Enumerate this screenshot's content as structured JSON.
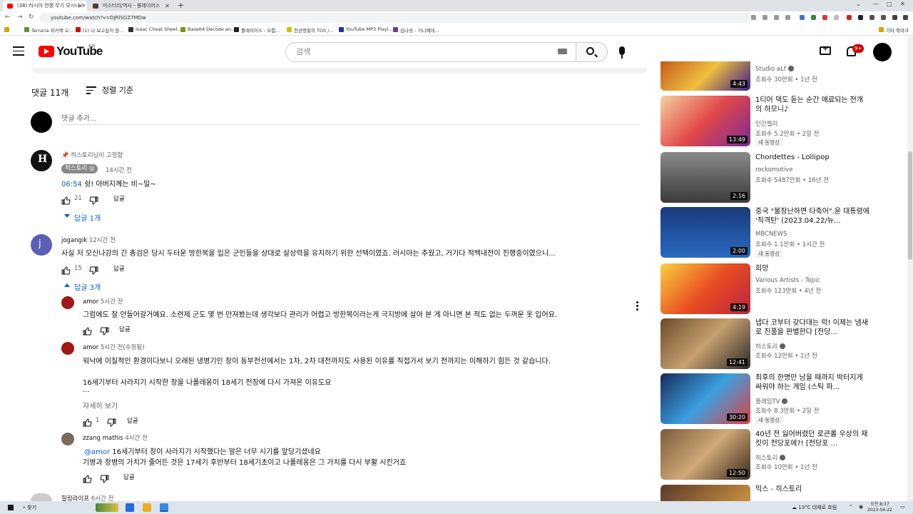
{
  "browser": {
    "tabs": [
      {
        "label": "(38) 러시아 전쟁 무기 모시나 ㅎ",
        "active": true
      },
      {
        "label": "미스터리/역사 - 롤레이어스",
        "active": false
      }
    ],
    "url": "youtube.com/watch?v=DJRlSGZ7MDw",
    "bookmarks": [
      "Terraria 위키백 오...",
      "(1) 나 보고싶지 않...",
      "Isaac Cheat Sheet...",
      "Base64 Decode an...",
      "롤레이어스 - 모험...",
      "천상병들의 TOS /...",
      "YouTube MP3 Playl...",
      "김나성 - 거니예데..."
    ],
    "other_bookmarks": "기타 북마크"
  },
  "header": {
    "logo_text": "YouTube",
    "region": "KR",
    "search_placeholder": "검색",
    "notif_count": "9+"
  },
  "comments_header": {
    "count": "댓글 11개",
    "sort_label": "정렬 기준",
    "add_placeholder": "댓글 추가..."
  },
  "comments": {
    "pinned": {
      "pinned_label": "히스토리님이 고정함",
      "author": "히스토리",
      "time": "14시간 전",
      "timestamp_link": "06:54",
      "text": " 쉿! 아버지께는 비~밀~",
      "likes": "21",
      "reply": "답글",
      "replies_toggle": "답글 1개"
    },
    "second": {
      "author": "jogangik",
      "time": "12시간 전",
      "text": "사실 저 모신나강의 긴 총검은 당시 두터운 방한복을 입은 군인들을 상대로 살상력을 유지하기 위한 선택이였죠. 러시아는 추웠고, 거기다 적백내전이 진행중이였으니...",
      "likes": "15",
      "reply": "답글",
      "replies_toggle": "답글 3개",
      "avatar_letter": "j"
    },
    "replies": [
      {
        "author": "amor",
        "time": "5시간 전",
        "text": "그럼에도 잘 안들어갈거예요. 소련제 군도 몇 번 만져봤는데 생각보다 관리가 어렵고 방한복이라는게 극지방에 살아 본 게 아니면 본 적도 없는 두꺼운 옷 입어요.",
        "reply": "답글"
      },
      {
        "author": "amor",
        "time": "5시간 전(수정됨)",
        "line1": "워낙에 이질적인 환경이다보니 오래된 냉병기인 창이 동부전선에서는 1차, 2차 대전까지도 사용된 이유를 직접가서 보기 전까지는 이해하기 힘든 것 같습니다.",
        "line2": "16세기부터 사라지기 시작한 창을 나폴레옹이 18세기 전장에 다시 가져온 이유도요",
        "line3": "...",
        "show_more": "자세히 보기",
        "likes": "1",
        "reply": "답글"
      },
      {
        "author": "zzang mathis",
        "time": "4시간 전",
        "mention": "@amor",
        "line1": " 16세기부터 창이 사라지기 시작했다는 말은 너무 시기를 앞당기셨네요",
        "line2": "기병과 창병의 가치가 줄어든 것은 17세기 후반부터 18세기초이고 나폴레옹은 그 가치를 다시 부활 시킨거죠",
        "reply": "답글"
      }
    ],
    "next_author": "힐링라이프",
    "next_time": "6시간 전"
  },
  "sidebar": {
    "videos": [
      {
        "title": "",
        "channel": "Studio aLf",
        "meta": "조회수 30만회 • 1년 전",
        "duration": "4:43",
        "new": ""
      },
      {
        "title": "1티어 덱도 듣는 순간 매료되는 전개의 하모니♪",
        "channel": "인간젤리",
        "meta": "조회수 5.2만회 • 2일 전",
        "duration": "13:49",
        "new": "새 동영상"
      },
      {
        "title": "Chordettes - Lollipop",
        "channel": "rockomotive",
        "meta": "조회수 5487만회 • 16년 전",
        "duration": "2:16",
        "new": ""
      },
      {
        "title": "중국 \"불장난하면 타죽어\".윤 대통령에 '직격탄' (2023.04.22/뉴...",
        "channel": "MBCNEWS",
        "meta": "조회수 1.1만회 • 1시간 전",
        "duration": "2:00",
        "new": "새 동영상"
      },
      {
        "title": "희망",
        "channel": "Various Artists - Topic",
        "meta": "조회수 123만회 • 4년 전",
        "duration": "4:19",
        "new": ""
      },
      {
        "title": "냅다 코부터 갖다대는 럭! 이제는 냄새로 진품을 판별한다 [전당...",
        "channel": "히스토리",
        "meta": "조회수 12만회 • 1년 전",
        "duration": "12:41",
        "new": ""
      },
      {
        "title": "최후의 한명만 남을 때까지 박터지게 싸워야 하는 게임 (스틱 파...",
        "channel": "플레임TV",
        "meta": "조회수 8.3만회 • 2일 전",
        "duration": "30:20",
        "new": "새 동영상"
      },
      {
        "title": "40년 전 잃어버렸던 로큰롤 우상의 재킷이 전당포에?! [전당포 ...",
        "channel": "히스토리",
        "meta": "조회수 10만회 • 1년 전",
        "duration": "12:50",
        "new": ""
      },
      {
        "title": "믹스 - 히스토리",
        "channel": "",
        "meta": "",
        "duration": "",
        "new": ""
      }
    ]
  },
  "taskbar": {
    "search": "찾기",
    "weather": "13°C 대체로 흐림",
    "time": "오전 8:37",
    "date": "2023-04-22"
  }
}
